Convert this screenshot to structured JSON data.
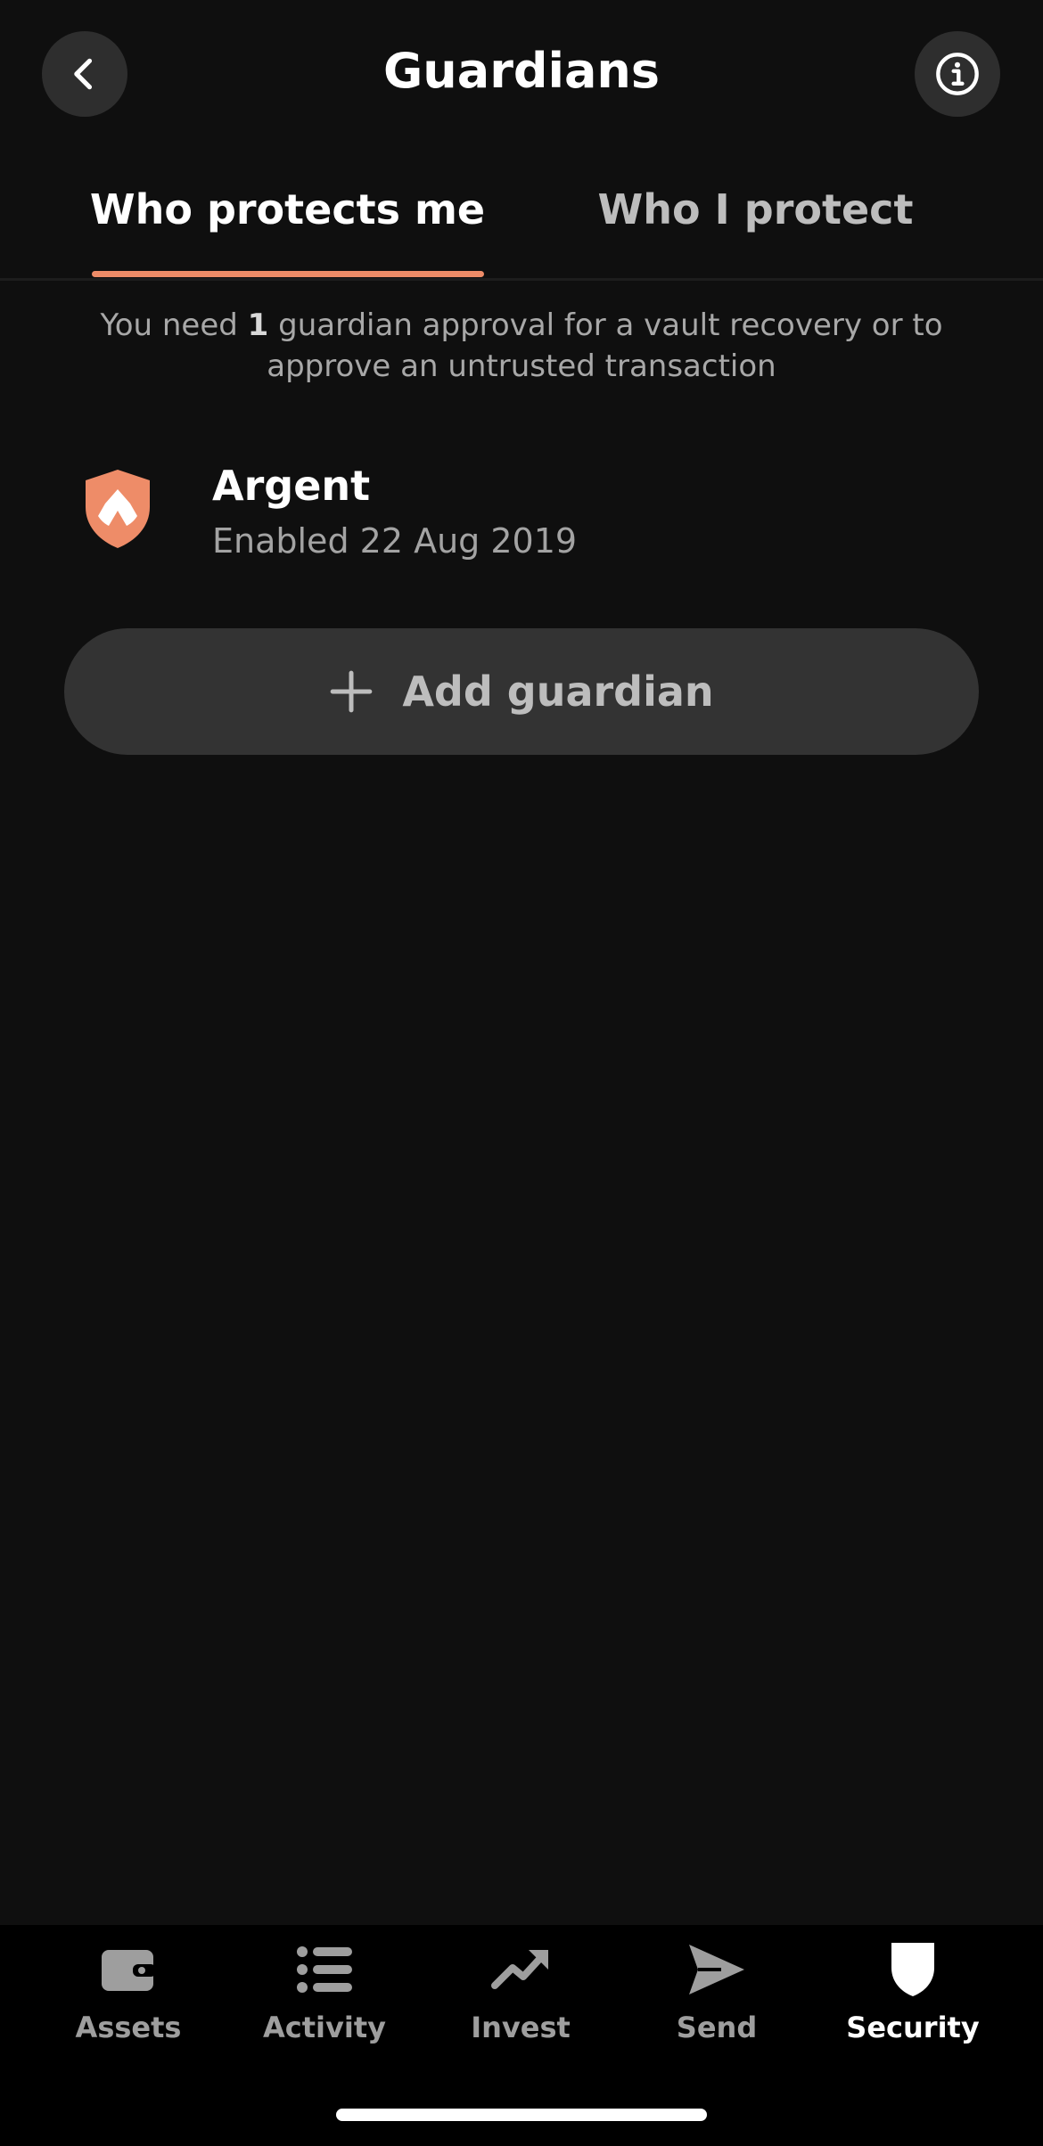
{
  "header": {
    "title": "Guardians",
    "back_icon": "chevron-left-icon",
    "info_icon": "info-icon"
  },
  "tabs": [
    {
      "label": "Who protects me",
      "active": true
    },
    {
      "label": "Who I protect",
      "active": false
    }
  ],
  "info": {
    "prefix": "You need ",
    "count": "1",
    "suffix": " guardian approval for a vault recovery or to approve an untrusted transaction"
  },
  "guardians": [
    {
      "name": "Argent",
      "status": "Enabled 22 Aug 2019",
      "icon": "argent-shield-icon",
      "icon_color": "#ee8c68"
    }
  ],
  "add_guardian": {
    "label": "Add guardian",
    "icon": "plus-icon"
  },
  "bottom_nav": [
    {
      "label": "Assets",
      "icon": "wallet-icon",
      "active": false
    },
    {
      "label": "Activity",
      "icon": "list-icon",
      "active": false
    },
    {
      "label": "Invest",
      "icon": "trending-up-icon",
      "active": false
    },
    {
      "label": "Send",
      "icon": "send-icon",
      "active": false
    },
    {
      "label": "Security",
      "icon": "shield-icon",
      "active": true
    }
  ],
  "colors": {
    "background": "#0f0f0f",
    "accent": "#ee8c68",
    "button_bg": "#333333",
    "nav_bg": "#000000"
  }
}
